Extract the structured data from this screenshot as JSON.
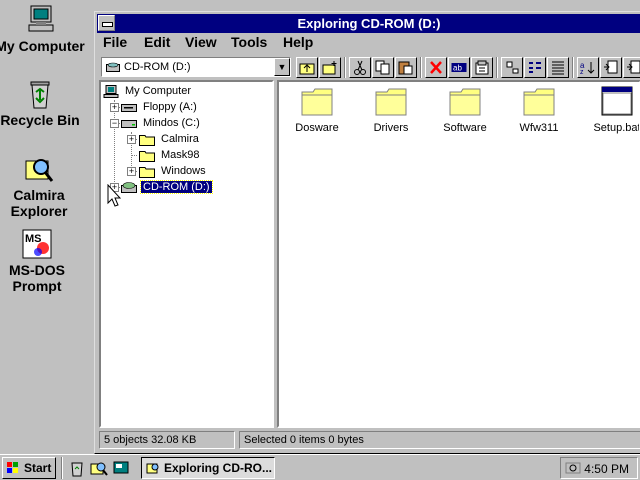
{
  "desktop": {
    "icons": [
      {
        "label": "My Computer",
        "icon": "my-computer-icon"
      },
      {
        "label": "Recycle Bin",
        "icon": "recycle-bin-icon"
      },
      {
        "label_line1": "Calmira",
        "label_line2": "Explorer",
        "icon": "calmira-explorer-icon"
      },
      {
        "label_line1": "MS-DOS",
        "label_line2": "Prompt",
        "icon": "ms-dos-icon"
      }
    ]
  },
  "window": {
    "title": "Exploring CD-ROM (D:)",
    "menu": [
      {
        "label": "File"
      },
      {
        "label": "Edit"
      },
      {
        "label": "View"
      },
      {
        "label": "Tools"
      },
      {
        "label": "Help"
      }
    ],
    "drive_combo": {
      "value": "CD-ROM (D:)"
    },
    "tree": [
      {
        "label": "My Computer",
        "icon": "computer-icon"
      },
      {
        "label": "Floppy (A:)",
        "icon": "floppy-drive-icon"
      },
      {
        "label": "Mindos (C:)",
        "icon": "hard-drive-icon"
      },
      {
        "label": "Calmira",
        "icon": "folder-icon"
      },
      {
        "label": "Mask98",
        "icon": "folder-icon"
      },
      {
        "label": "Windows",
        "icon": "folder-icon"
      },
      {
        "label": "CD-ROM (D:)",
        "icon": "cd-rom-icon",
        "selected": true
      }
    ],
    "files": [
      {
        "name": "Dosware",
        "icon": "folder-icon"
      },
      {
        "name": "Drivers",
        "icon": "folder-icon"
      },
      {
        "name": "Software",
        "icon": "folder-icon"
      },
      {
        "name": "Wfw311",
        "icon": "folder-icon"
      },
      {
        "name": "Setup.bat",
        "icon": "batch-file-icon"
      }
    ],
    "status": {
      "objects": "5 objects  32.08 KB",
      "selected": "Selected 0 items  0 bytes"
    }
  },
  "taskbar": {
    "start_label": "Start",
    "task_label": "Exploring CD-RO...",
    "clock": "4:50 PM"
  }
}
